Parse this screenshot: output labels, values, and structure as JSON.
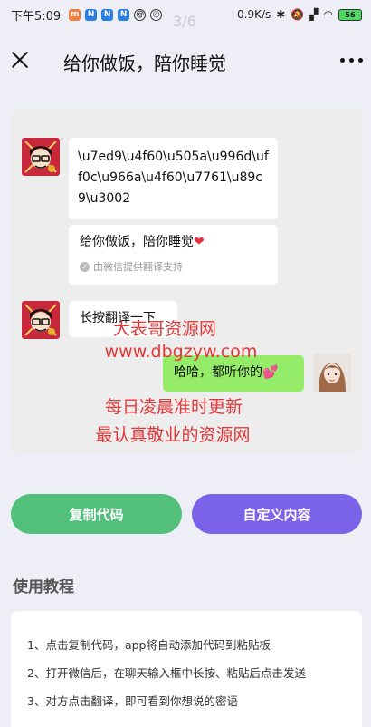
{
  "status_bar": {
    "time": "下午5:09",
    "page_indicator": "3/6",
    "speed": "0.9K/s",
    "battery": "56"
  },
  "header": {
    "title": "给你做饭，陪你睡觉"
  },
  "chat": {
    "message1": "\\u7ed9\\u4f60\\u505a\\u996d\\uff0c\\u966a\\u4f60\\u7761\\u89c9\\u3002",
    "translation": "给你做饭，陪你睡觉",
    "translation_heart": "❤",
    "translation_note": "由微信提供翻译支持",
    "message2": "长按翻译一下",
    "reply": "哈哈，都听你的",
    "reply_emoji": "💕"
  },
  "watermark": {
    "line1": "大表哥资源网",
    "line2": "www.dbgzyw.com",
    "line3": "每日凌晨准时更新",
    "line4": "最认真敬业的资源网"
  },
  "buttons": {
    "copy": "复制代码",
    "custom": "自定义内容"
  },
  "tutorial": {
    "title": "使用教程",
    "steps": [
      "1、点击复制代码，app将自动添加代码到粘贴板",
      "2、打开微信后，在聊天输入框中长按、粘贴后点击发送",
      "3、对方点击翻译，即可看到你想说的密语"
    ]
  },
  "colors": {
    "copy_button": "#52c07b",
    "custom_button": "#7a63e8",
    "reply_bubble": "#95ec69",
    "watermark": "#e43838"
  }
}
